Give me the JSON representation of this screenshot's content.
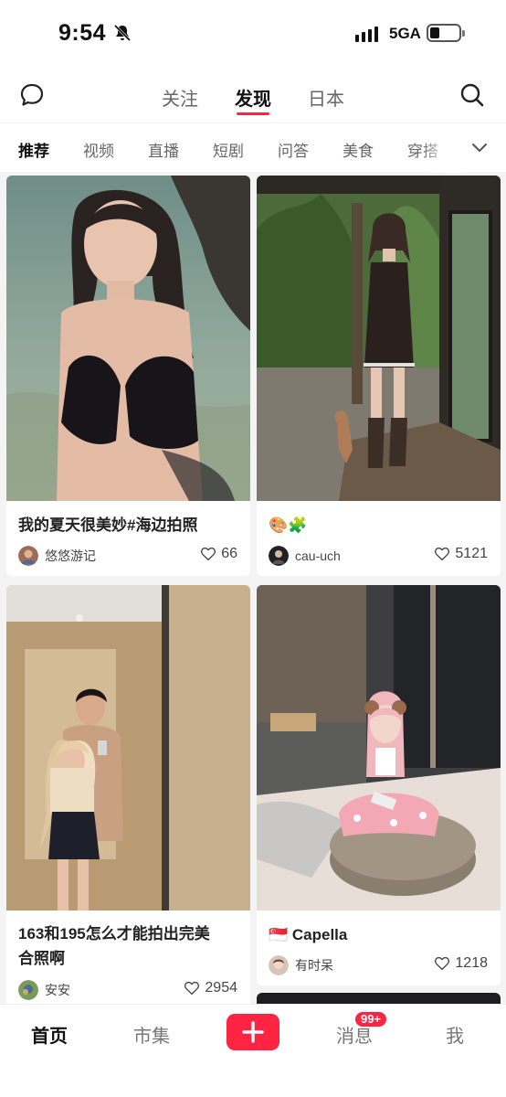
{
  "status_bar": {
    "time": "9:54",
    "network": "5GA"
  },
  "header": {
    "tabs": [
      "关注",
      "发现",
      "日本"
    ],
    "active_tab": "发现"
  },
  "categories": [
    "推荐",
    "视频",
    "直播",
    "短剧",
    "问答",
    "美食",
    "穿搭"
  ],
  "feed": [
    {
      "title": "我的夏天很美妙#海边拍照",
      "author": "悠悠游记",
      "likes": "66"
    },
    {
      "title": "🎨🧩",
      "author": "cau-uch",
      "likes": "5121"
    },
    {
      "title": "163和195怎么才能拍出完美\n合照啊",
      "author": "安安",
      "likes": "2954"
    },
    {
      "title": "🇸🇬 Capella",
      "author": "有时呆",
      "likes": "1218"
    }
  ],
  "bottom_nav": {
    "home": "首页",
    "market": "市集",
    "messages": "消息",
    "messages_badge": "99+",
    "me": "我"
  },
  "colors": {
    "accent": "#ff2442",
    "background": "#f4f4f4"
  }
}
